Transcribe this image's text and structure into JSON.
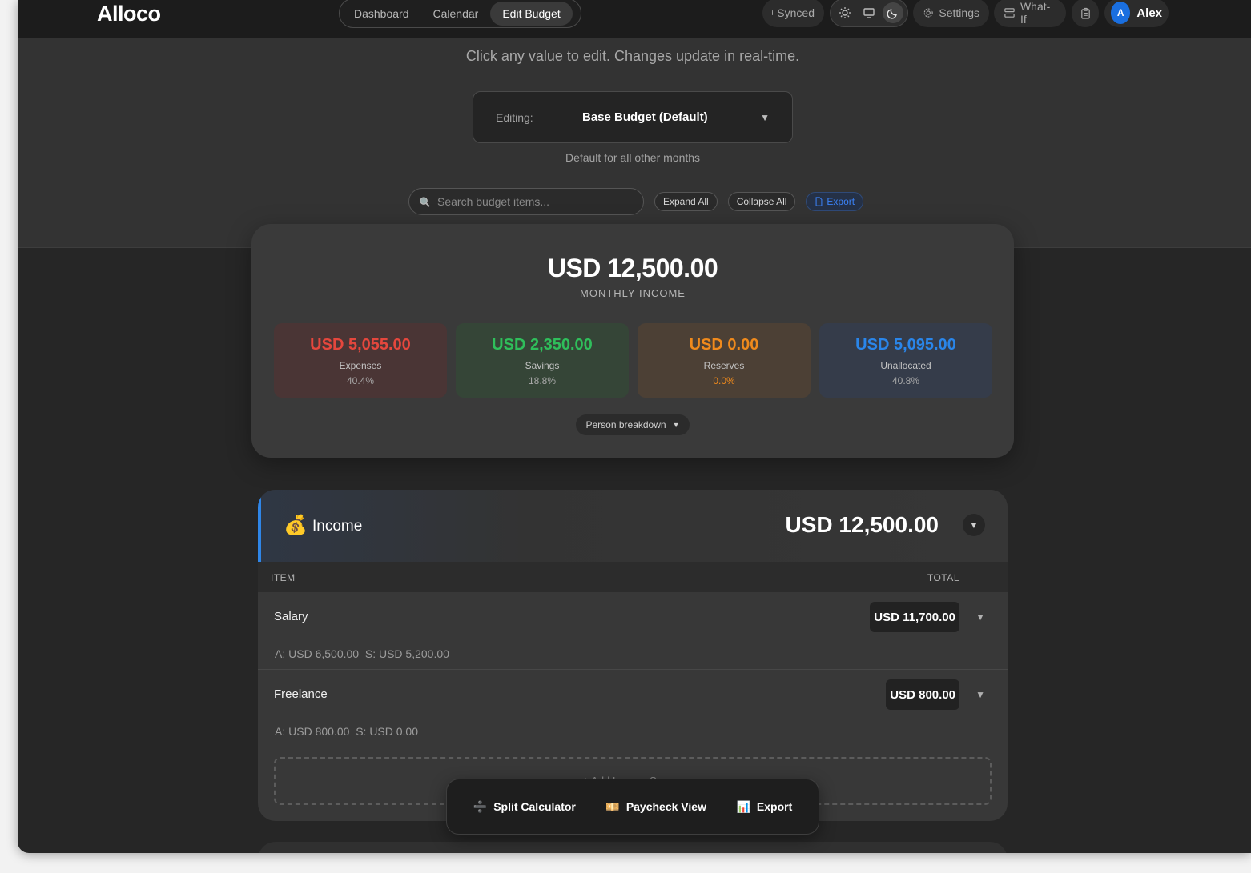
{
  "app": {
    "name": "Alloco"
  },
  "nav": {
    "tabs": [
      "Dashboard",
      "Calendar",
      "Edit Budget"
    ],
    "active": "Edit Budget"
  },
  "topbar": {
    "sync_status": "Synced",
    "settings_label": "Settings",
    "whatif_label": "What-If",
    "user": {
      "initial": "A",
      "name": "Alex"
    },
    "theme_icons": [
      "sun-icon",
      "monitor-icon",
      "moon-icon"
    ]
  },
  "hint": "Click any value to edit. Changes update in real-time.",
  "scenario": {
    "label": "Editing:",
    "value": "Base Budget (Default)",
    "note": "Default for all other months"
  },
  "toolbar": {
    "search_placeholder": "Search budget items...",
    "expand_all": "Expand All",
    "collapse_all": "Collapse All",
    "export": "Export"
  },
  "summary": {
    "amount": "USD 12,500.00",
    "label": "MONTHLY INCOME",
    "stats": [
      {
        "value": "USD 5,055.00",
        "name": "Expenses",
        "pct": "40.4%",
        "color": "#e5473d"
      },
      {
        "value": "USD 2,350.00",
        "name": "Savings",
        "pct": "18.8%",
        "color": "#2fbf5b"
      },
      {
        "value": "USD 0.00",
        "name": "Reserves",
        "pct": "0.0%",
        "color": "#f08a1c"
      },
      {
        "value": "USD 5,095.00",
        "name": "Unallocated",
        "pct": "40.8%",
        "color": "#2a86ea"
      }
    ],
    "person_breakdown": "Person breakdown"
  },
  "income": {
    "icon": "💰",
    "title": "Income",
    "total": "USD 12,500.00",
    "col_item": "ITEM",
    "col_total": "TOTAL",
    "rows": [
      {
        "name": "Salary",
        "value": "USD 11,700.00",
        "a_label": "A:",
        "a_value": "USD 6,500.00",
        "s_label": "S:",
        "s_value": "USD 5,200.00"
      },
      {
        "name": "Freelance",
        "value": "USD 800.00",
        "a_label": "A:",
        "a_value": "USD 800.00",
        "s_label": "S:",
        "s_value": "USD 0.00"
      }
    ],
    "add_label": "+ Add Income Source"
  },
  "float_bar": {
    "items": [
      {
        "icon": "➗",
        "label": "Split Calculator"
      },
      {
        "icon": "💴",
        "label": "Paycheck View"
      },
      {
        "icon": "📊",
        "label": "Export"
      }
    ]
  }
}
